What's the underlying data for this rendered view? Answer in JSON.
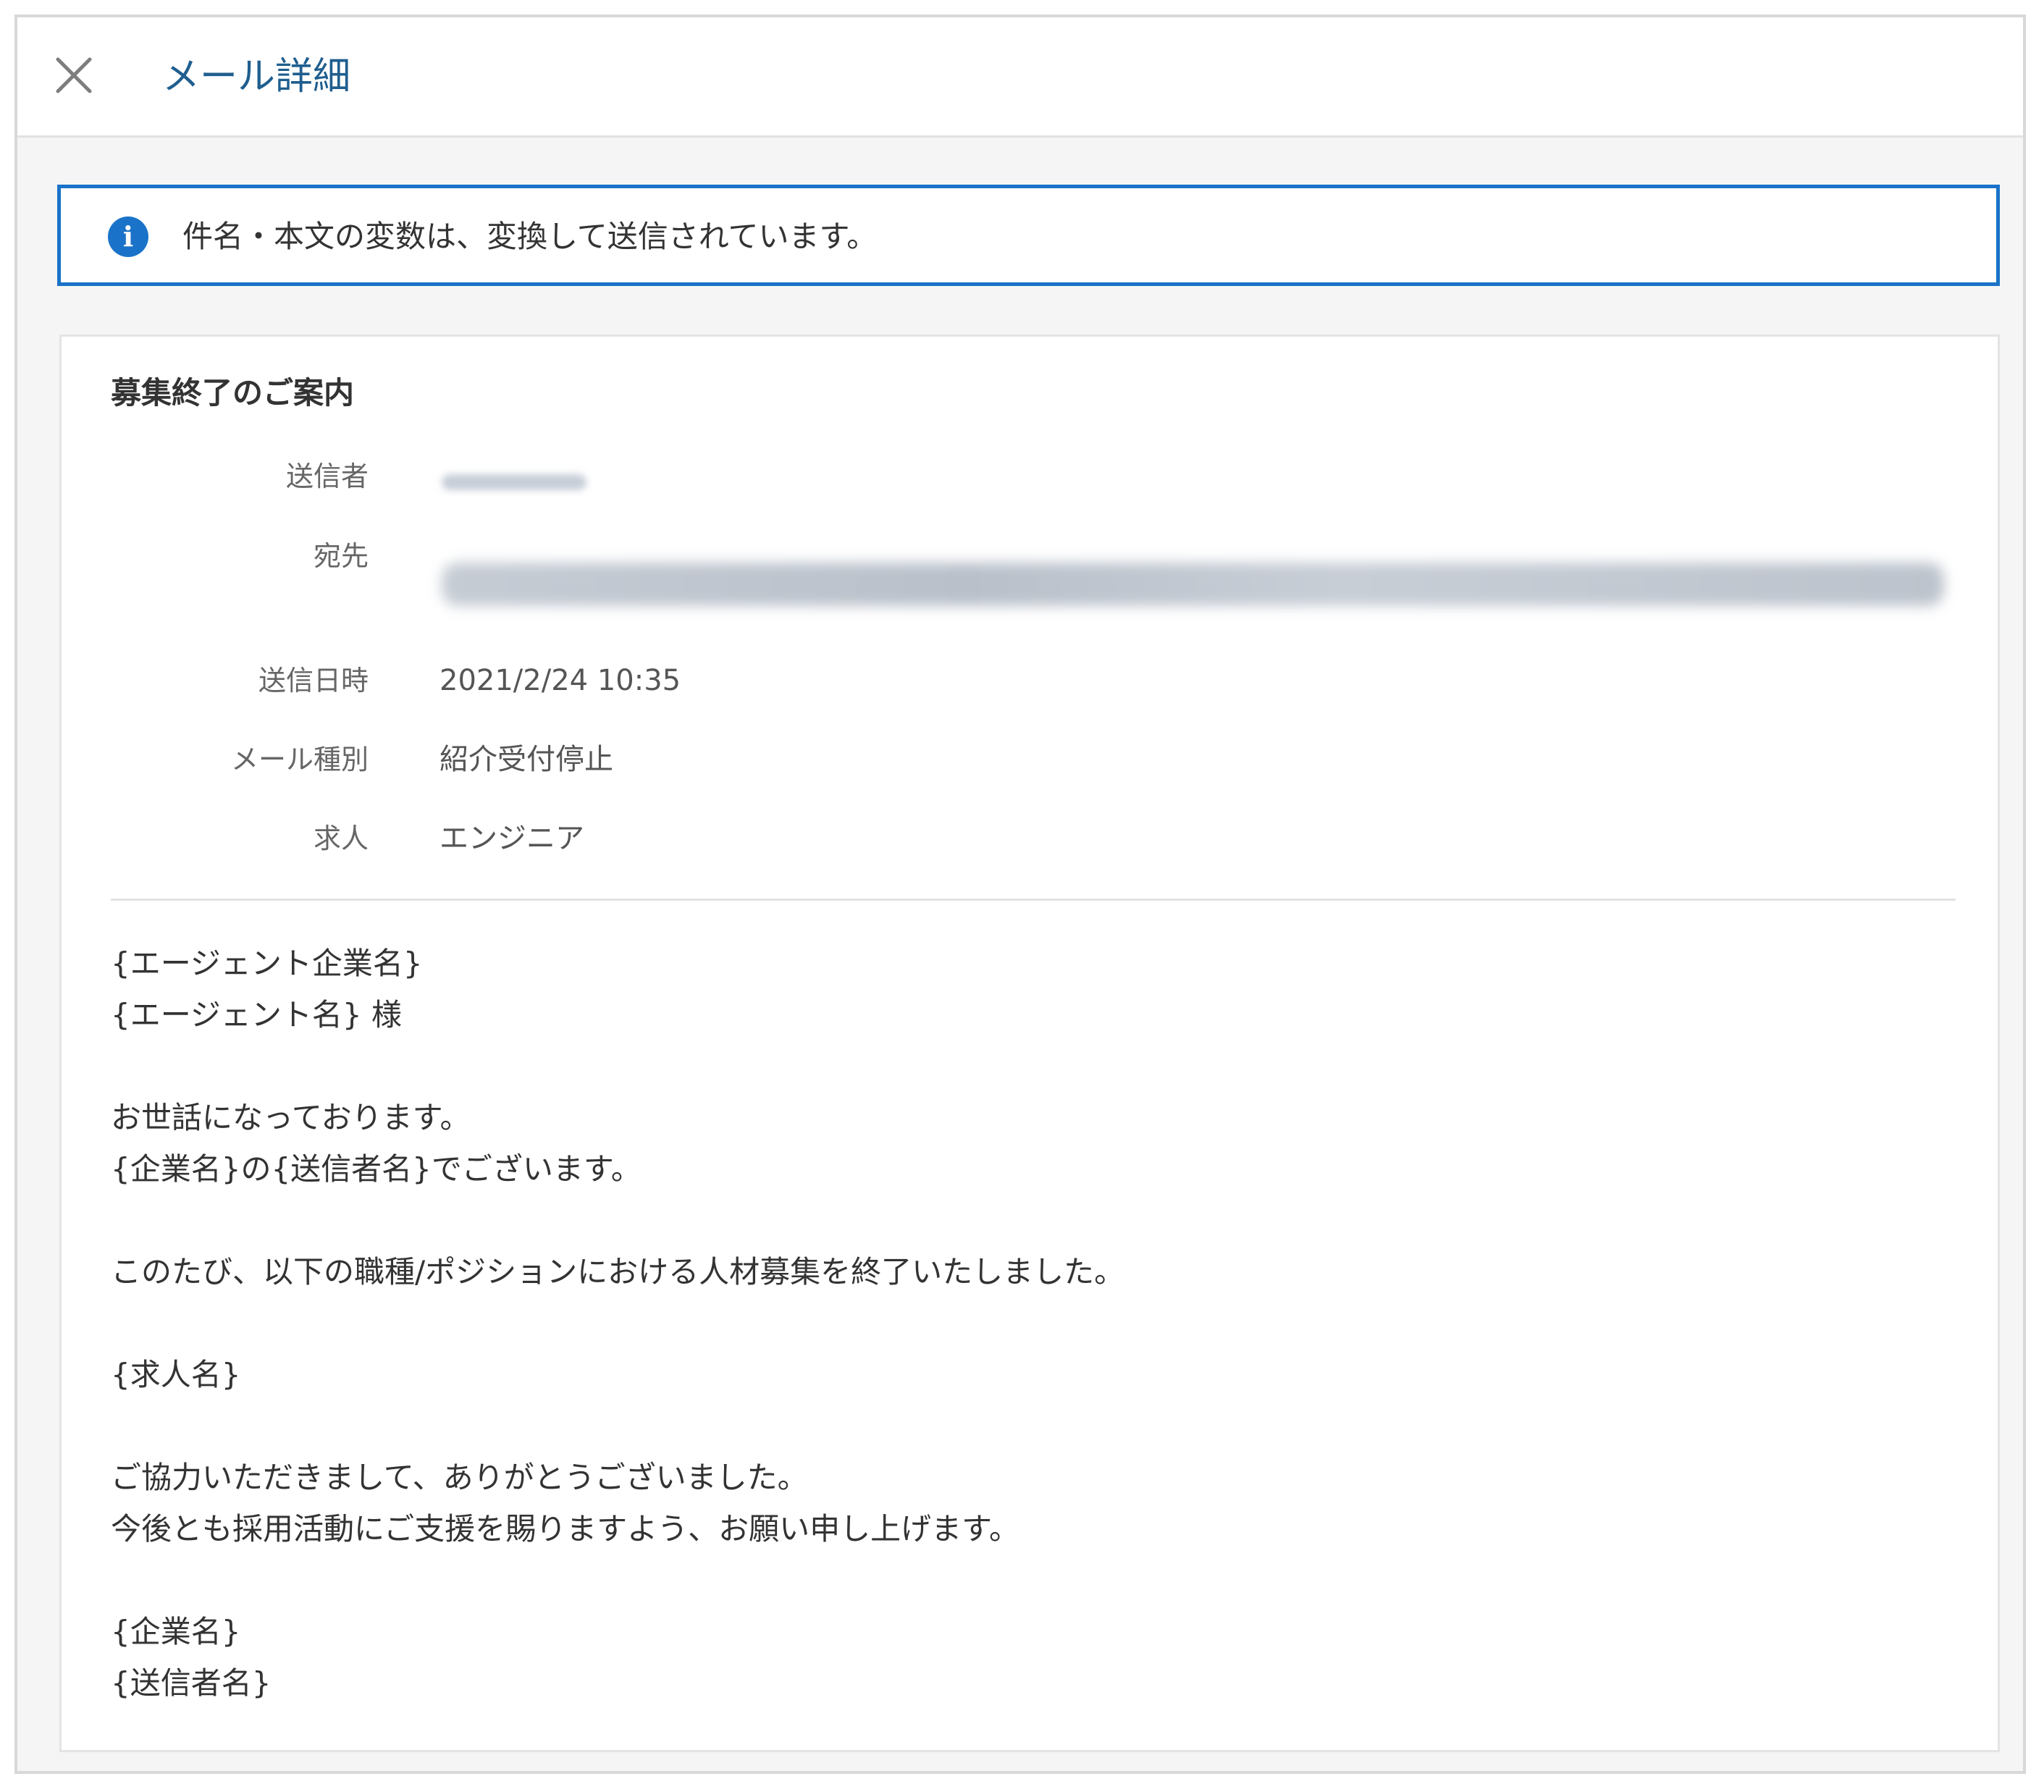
{
  "header": {
    "title": "メール詳細",
    "close_icon": "close-icon"
  },
  "notice": {
    "icon": "info-icon",
    "icon_glyph": "i",
    "text": "件名・本文の変数は、変換して送信されています。",
    "accent_color": "#1a73c8"
  },
  "mail": {
    "subject": "募集終了のご案内",
    "fields": {
      "sender_label": "送信者",
      "recipient_label": "宛先",
      "sent_at_label": "送信日時",
      "sent_at_value": "2021/2/24 10:35",
      "mail_type_label": "メール種別",
      "mail_type_value": "紹介受付停止",
      "job_label": "求人",
      "job_value": "エンジニア"
    },
    "body": "{エージェント企業名}\n{エージェント名} 様\n\nお世話になっております。\n{企業名}の{送信者名}でございます。\n\nこのたび、以下の職種/ポジションにおける人材募集を終了いたしました。\n\n{求人名}\n\nご協力いただきまして、ありがとうございました。\n今後とも採用活動にご支援を賜りますよう、お願い申し上げます。\n\n{企業名}\n{送信者名}"
  }
}
